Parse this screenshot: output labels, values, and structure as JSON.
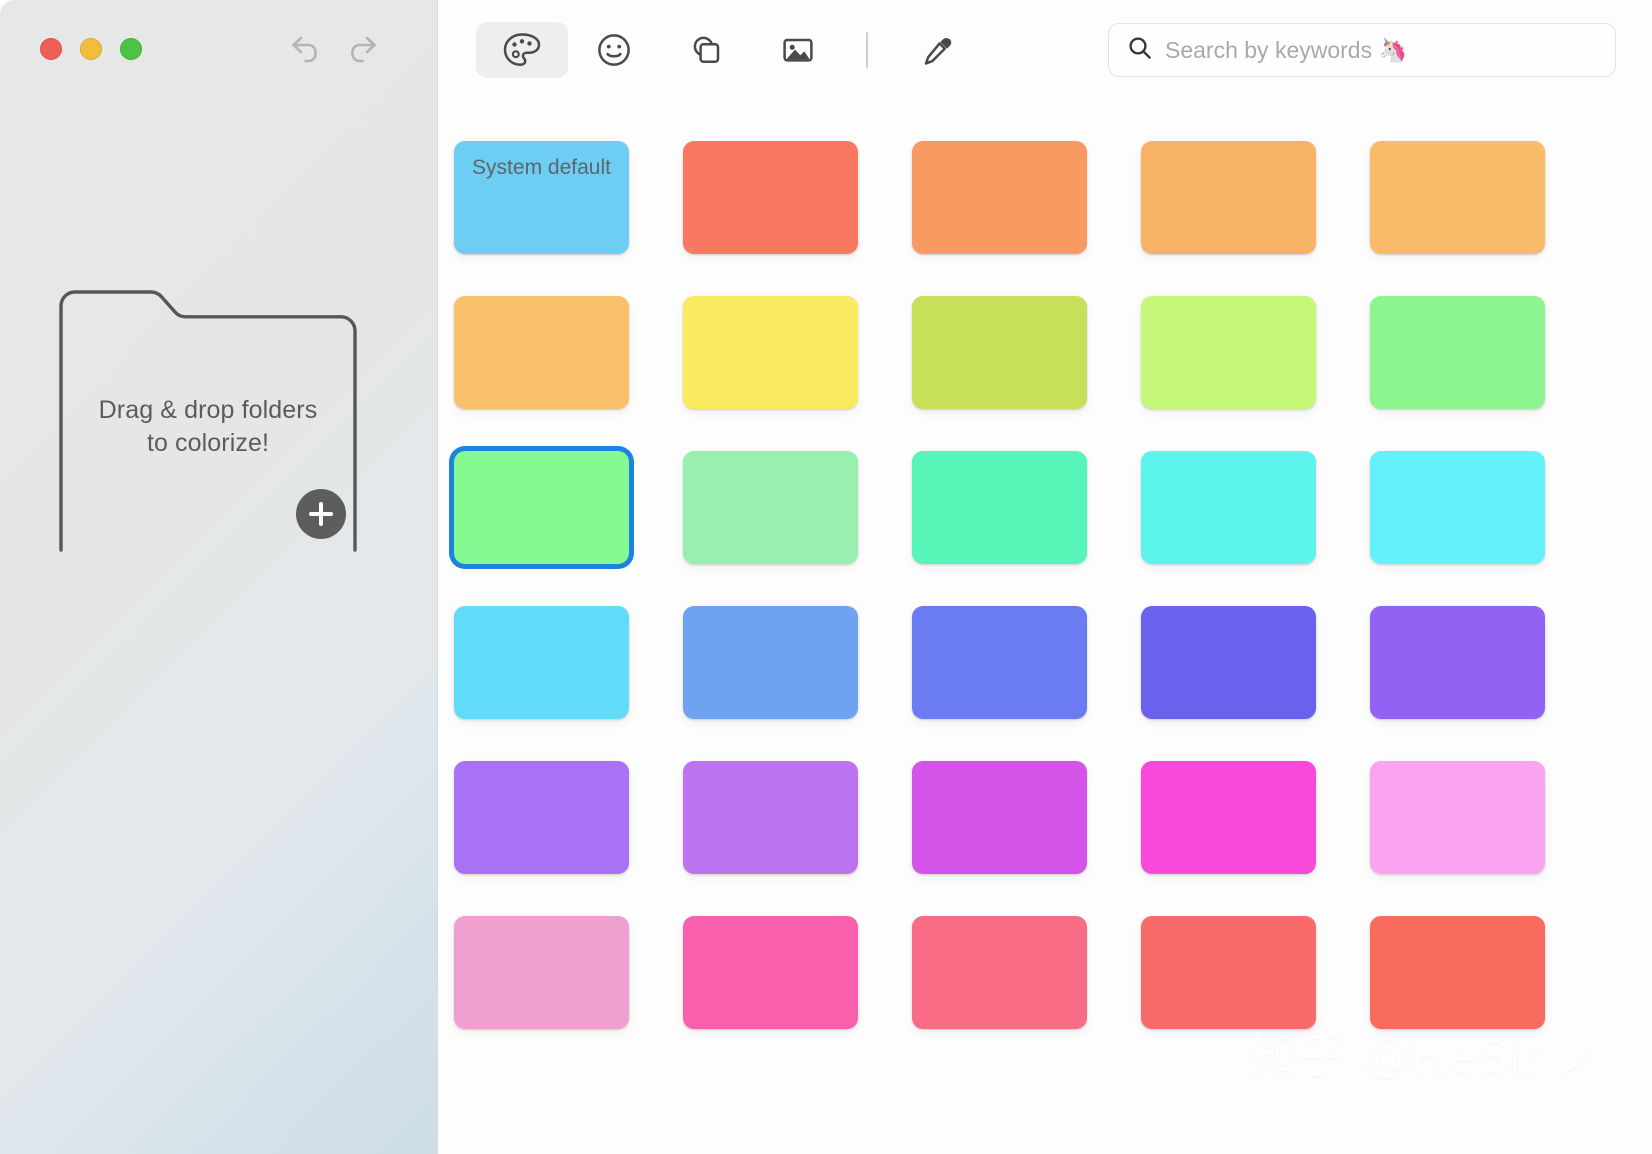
{
  "window": {
    "traffic_lights": [
      {
        "name": "close",
        "color": "#ee5f55"
      },
      {
        "name": "minimize",
        "color": "#f2bd3c"
      },
      {
        "name": "zoom",
        "color": "#4cc246"
      }
    ],
    "history": [
      {
        "name": "undo",
        "icon": "undo-icon"
      },
      {
        "name": "redo",
        "icon": "redo-icon"
      }
    ]
  },
  "sidebar": {
    "drop_zone": {
      "line1": "Drag & drop folders",
      "line2": "to colorize!",
      "add_button_icon": "plus-icon"
    }
  },
  "toolbar": {
    "tools": [
      {
        "id": "palette",
        "icon": "palette-icon",
        "active": true
      },
      {
        "id": "emoji",
        "icon": "smiley-icon",
        "active": false
      },
      {
        "id": "shapes",
        "icon": "shapes-icon",
        "active": false
      },
      {
        "id": "image",
        "icon": "image-icon",
        "active": false
      },
      {
        "id": "eyedropper",
        "icon": "eyedropper-icon",
        "active": false
      }
    ],
    "divider_after": "image"
  },
  "search": {
    "icon": "search-icon",
    "value": "",
    "placeholder": "Search by keywords 🦄"
  },
  "swatches": {
    "selected_index": 10,
    "items": [
      {
        "index": 0,
        "color": "#6dcdf2",
        "label": "System default"
      },
      {
        "index": 1,
        "color": "#f97862",
        "label": ""
      },
      {
        "index": 2,
        "color": "#f99a63",
        "label": ""
      },
      {
        "index": 3,
        "color": "#f7b268",
        "label": ""
      },
      {
        "index": 4,
        "color": "#f8bb69",
        "label": ""
      },
      {
        "index": 5,
        "color": "#f8c169",
        "label": ""
      },
      {
        "index": 6,
        "color": "#f9ea5f",
        "label": ""
      },
      {
        "index": 7,
        "color": "#c7e05a",
        "label": ""
      },
      {
        "index": 8,
        "color": "#c5f878",
        "label": ""
      },
      {
        "index": 9,
        "color": "#8cf58f",
        "label": ""
      },
      {
        "index": 10,
        "color": "#85f992",
        "label": ""
      },
      {
        "index": 11,
        "color": "#99efb0",
        "label": ""
      },
      {
        "index": 12,
        "color": "#57f5b8",
        "label": ""
      },
      {
        "index": 13,
        "color": "#5cf4ed",
        "label": ""
      },
      {
        "index": 14,
        "color": "#63f2fb",
        "label": ""
      },
      {
        "index": 15,
        "color": "#62dbf8",
        "label": ""
      },
      {
        "index": 16,
        "color": "#6ea3f2",
        "label": ""
      },
      {
        "index": 17,
        "color": "#6b7cf2",
        "label": ""
      },
      {
        "index": 18,
        "color": "#6a62ec",
        "label": ""
      },
      {
        "index": 19,
        "color": "#9162f4",
        "label": ""
      },
      {
        "index": 20,
        "color": "#a872f4",
        "label": ""
      },
      {
        "index": 21,
        "color": "#bd72ee",
        "label": ""
      },
      {
        "index": 22,
        "color": "#d453e8",
        "label": ""
      },
      {
        "index": 23,
        "color": "#f949da",
        "label": ""
      },
      {
        "index": 24,
        "color": "#fba3ee",
        "label": ""
      },
      {
        "index": 25,
        "color": "#f0a0cf",
        "label": ""
      },
      {
        "index": 26,
        "color": "#f95fab",
        "label": ""
      },
      {
        "index": 27,
        "color": "#f96c86",
        "label": ""
      },
      {
        "index": 28,
        "color": "#f96a6a",
        "label": ""
      },
      {
        "index": 29,
        "color": "#f96b5e",
        "label": ""
      }
    ]
  },
  "watermark": {
    "text": "知乎 @HeSir ノ"
  },
  "colors": {
    "selection_blue": "#1e83e0",
    "sidebar_base": "#e6e8e8",
    "sidebar_tint": "#ccdde8",
    "panel_bg": "#fdfdfd"
  }
}
